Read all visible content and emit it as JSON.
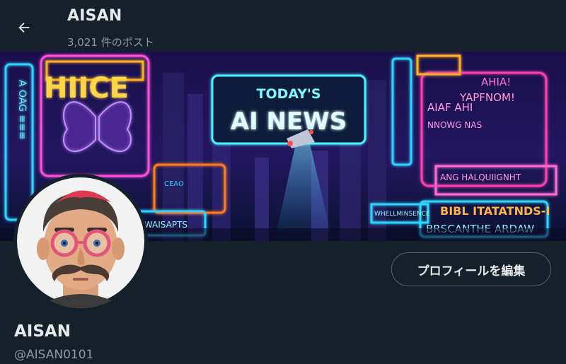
{
  "header": {
    "title": "AISAN",
    "post_count": "3,021 件のポスト",
    "back_icon": "arrow-left-icon"
  },
  "banner": {
    "headline_top": "TODAY'S",
    "headline_main": "AI NEWS",
    "neon_signs": [
      "AHIA!",
      "YAPFNOM!",
      "AIAF AHI",
      "NNOWG NAS",
      "ANG HALQUIIGNHT",
      "BIBL ITATATNDS-I",
      "BRSCANTHE ARDAW",
      "WHELLMINSENCE",
      "BEWAISAPTS",
      "CE"
    ]
  },
  "profile": {
    "name": "AISAN",
    "handle": "@AISAN0101",
    "edit_button_label": "プロフィールを編集"
  },
  "colors": {
    "background": "#15202b",
    "text_primary": "#e7e9ea",
    "text_secondary": "#8b98a5",
    "button_border": "#536471"
  }
}
